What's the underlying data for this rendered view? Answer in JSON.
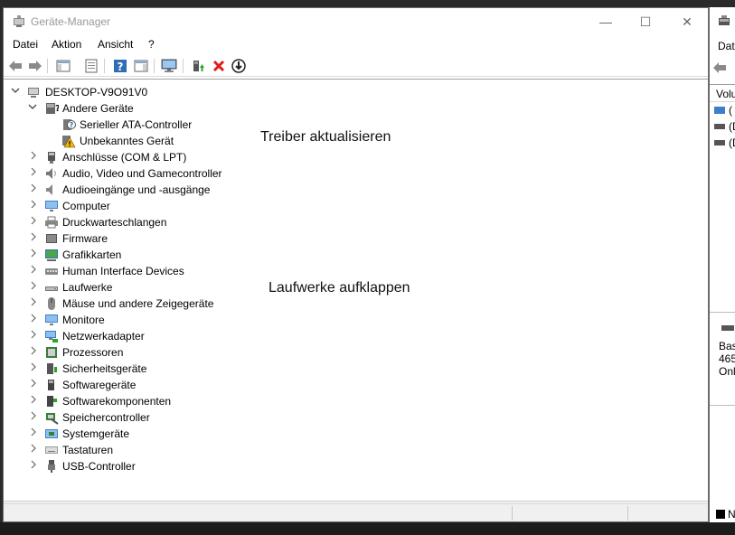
{
  "window": {
    "title": "Geräte-Manager",
    "controls": {
      "minimize": "—",
      "maximize": "☐",
      "close": "✕"
    }
  },
  "menu": [
    {
      "label": "Datei"
    },
    {
      "label": "Aktion"
    },
    {
      "label": "Ansicht"
    },
    {
      "label": "?"
    }
  ],
  "toolbar": {
    "buttons": [
      "back-arrow-icon",
      "forward-arrow-icon",
      "show-hide-console-tree-icon",
      "properties-icon",
      "help-icon",
      "action-pane-icon",
      "scan-hardware-icon",
      "update-driver-icon",
      "uninstall-device-icon",
      "disable-device-icon"
    ]
  },
  "tree": {
    "root": "DESKTOP-V9O91V0",
    "expanded_group": "Andere Geräte",
    "expanded_children": [
      "Serieller ATA-Controller",
      "Unbekanntes Gerät"
    ],
    "categories": [
      "Anschlüsse (COM & LPT)",
      "Audio, Video und Gamecontroller",
      "Audioeingänge und -ausgänge",
      "Computer",
      "Druckwarteschlangen",
      "Firmware",
      "Grafikkarten",
      "Human Interface Devices",
      "Laufwerke",
      "Mäuse und andere Zeigegeräte",
      "Monitore",
      "Netzwerkadapter",
      "Prozessoren",
      "Sicherheitsgeräte",
      "Softwaregeräte",
      "Softwarekomponenten",
      "Speichercontroller",
      "Systemgeräte",
      "Tastaturen",
      "USB-Controller"
    ]
  },
  "annotations": {
    "update_driver": "Treiber aktualisieren",
    "expand_drives": "Laufwerke aufklappen"
  },
  "second_window": {
    "menu_label": "Dat",
    "column_header": "Volu",
    "rows": [
      "(",
      "(D",
      "(D"
    ],
    "details": [
      "Bas",
      "465",
      "Onl"
    ],
    "footer": "N"
  },
  "colors": {
    "warning": "#f2b705",
    "delete_red": "#e01a1a",
    "accent_blue": "#2f6db5"
  }
}
